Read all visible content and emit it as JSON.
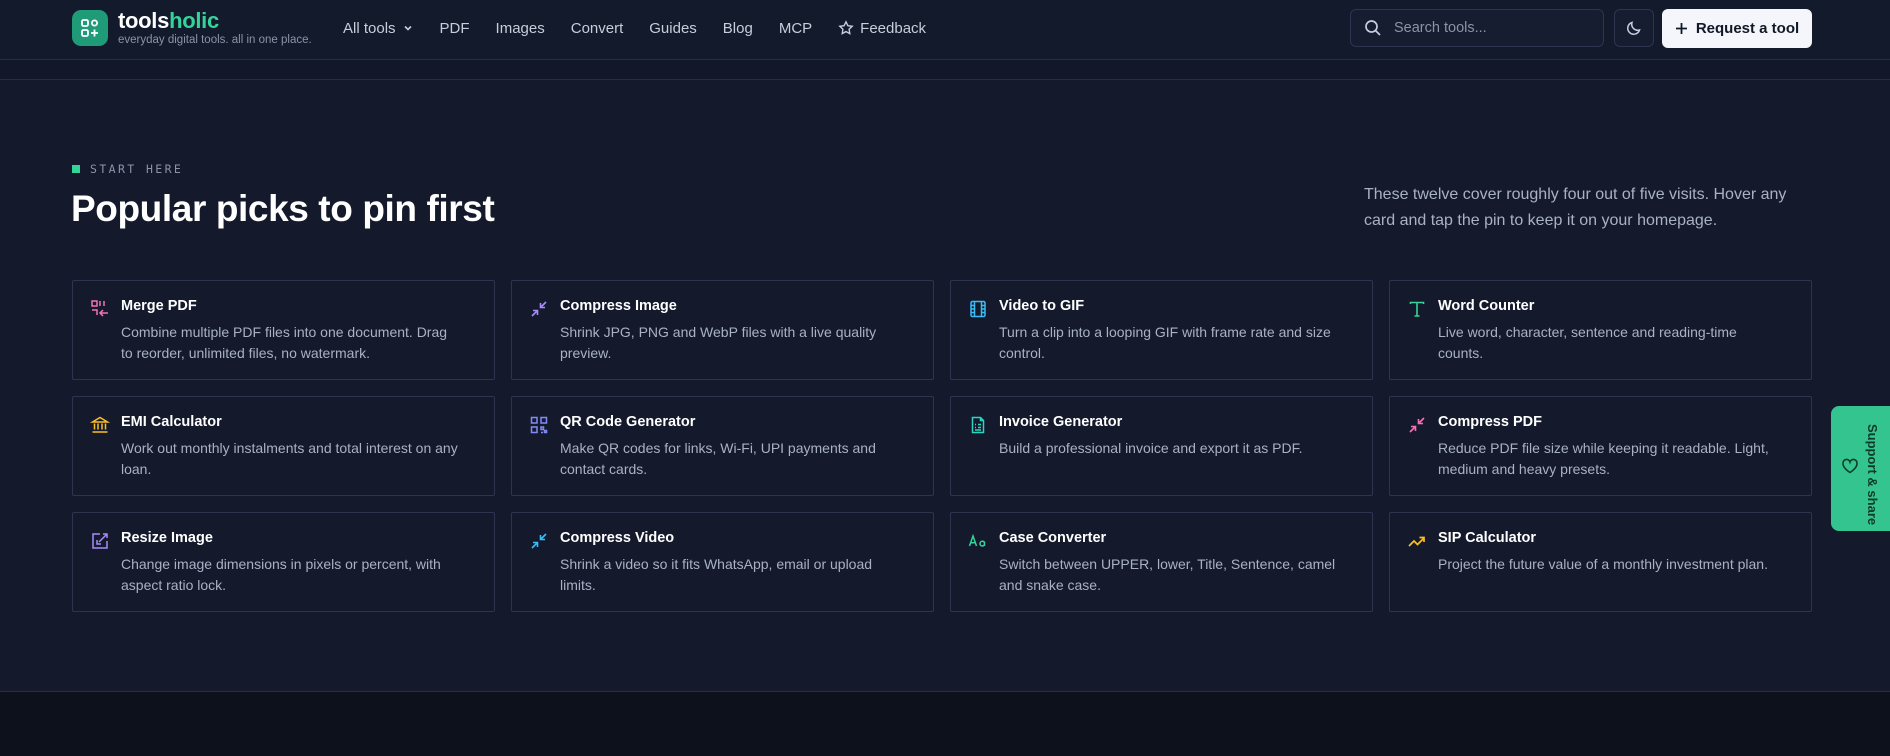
{
  "brand": {
    "name_main": "tools",
    "name_accent": "holic",
    "tagline": "everyday digital tools. all in one place."
  },
  "nav": [
    {
      "label": "All tools",
      "icon": "chevron-down-icon"
    },
    {
      "label": "PDF"
    },
    {
      "label": "Images"
    },
    {
      "label": "Convert"
    },
    {
      "label": "Guides"
    },
    {
      "label": "Blog"
    },
    {
      "label": "MCP"
    },
    {
      "label": "Feedback",
      "icon": "star-icon"
    }
  ],
  "search": {
    "placeholder": "Search tools..."
  },
  "header": {
    "request_label": "Request a tool"
  },
  "section": {
    "eyebrow": "START HERE",
    "title": "Popular picks to pin first",
    "lede": "These twelve cover roughly four out of five visits. Hover any card and tap the pin to keep it on your homepage."
  },
  "cards": [
    {
      "title": "Merge PDF",
      "desc": "Combine multiple PDF files into one document. Drag to reorder, unlimited files, no watermark.",
      "icon": "merge-icon",
      "color": "#f472b6"
    },
    {
      "title": "Compress Image",
      "desc": "Shrink JPG, PNG and WebP files with a live quality preview.",
      "icon": "compress-icon",
      "color": "#a78bfa"
    },
    {
      "title": "Video to GIF",
      "desc": "Turn a clip into a looping GIF with frame rate and size control.",
      "icon": "film-icon",
      "color": "#38bdf8"
    },
    {
      "title": "Word Counter",
      "desc": "Live word, character, sentence and reading-time counts.",
      "icon": "text-icon",
      "color": "#34d399"
    },
    {
      "title": "EMI Calculator",
      "desc": "Work out monthly instalments and total interest on any loan.",
      "icon": "bank-icon",
      "color": "#fbbf24"
    },
    {
      "title": "QR Code Generator",
      "desc": "Make QR codes for links, Wi-Fi, UPI payments and contact cards.",
      "icon": "qr-icon",
      "color": "#818cf8"
    },
    {
      "title": "Invoice Generator",
      "desc": "Build a professional invoice and export it as PDF.",
      "icon": "invoice-icon",
      "color": "#2dd4bf"
    },
    {
      "title": "Compress PDF",
      "desc": "Reduce PDF file size while keeping it readable. Light, medium and heavy presets.",
      "icon": "compress-icon",
      "color": "#f472b6"
    },
    {
      "title": "Resize Image",
      "desc": "Change image dimensions in pixels or percent, with aspect ratio lock.",
      "icon": "resize-icon",
      "color": "#a78bfa"
    },
    {
      "title": "Compress Video",
      "desc": "Shrink a video so it fits WhatsApp, email or upload limits.",
      "icon": "compress-icon",
      "color": "#38bdf8"
    },
    {
      "title": "Case Converter",
      "desc": "Switch between UPPER, lower, Title, Sentence, camel and snake case.",
      "icon": "case-icon",
      "color": "#34d399"
    },
    {
      "title": "SIP Calculator",
      "desc": "Project the future value of a monthly investment plan.",
      "icon": "trend-icon",
      "color": "#fbbf24"
    }
  ],
  "support": {
    "label": "Support & share"
  },
  "colors": {
    "accent": "#34d399",
    "background": "#141a2c"
  }
}
